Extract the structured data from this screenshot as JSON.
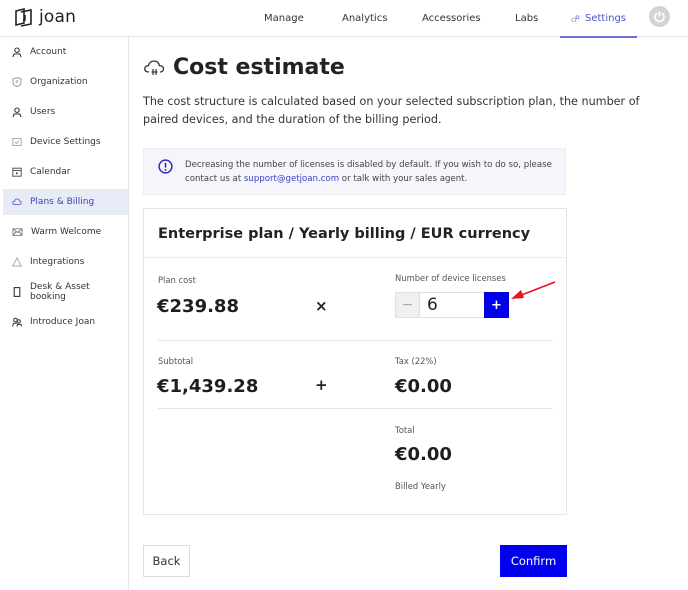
{
  "app": {
    "logo_text": "joan"
  },
  "topnav": {
    "items": [
      {
        "label": "Manage",
        "icon": "manage-icon",
        "active": false
      },
      {
        "label": "Analytics",
        "icon": "analytics-icon",
        "active": false
      },
      {
        "label": "Accessories",
        "icon": "basket-icon",
        "active": false
      },
      {
        "label": "Labs",
        "icon": "lightbulb-icon",
        "active": false
      },
      {
        "label": "Settings",
        "icon": "gears-icon",
        "active": true
      }
    ],
    "power_icon": "power-icon"
  },
  "sidebar": {
    "items": [
      {
        "label": "Account",
        "icon": "user-icon"
      },
      {
        "label": "Organization",
        "icon": "shield-icon"
      },
      {
        "label": "Users",
        "icon": "user-icon"
      },
      {
        "label": "Device Settings",
        "icon": "device-icon"
      },
      {
        "label": "Calendar",
        "icon": "calendar-icon"
      },
      {
        "label": "Plans & Billing",
        "icon": "cloud-icon",
        "active": true
      },
      {
        "label": "Warm Welcome",
        "icon": "envelope-icon"
      },
      {
        "label": "Integrations",
        "icon": "triangle-icon"
      },
      {
        "label": "Desk & Asset booking",
        "icon": "phone-icon"
      },
      {
        "label": "Introduce Joan",
        "icon": "users-icon"
      }
    ]
  },
  "page": {
    "title": "Cost estimate",
    "intro": "The cost structure is calculated based on your selected subscription plan, the number of paired devices, and the duration of the billing period.",
    "info": {
      "text_before": "Decreasing the number of licenses is disabled by default. If you wish to do so, please contact us at ",
      "link": "support@getjoan.com",
      "text_after": " or talk with your sales agent."
    }
  },
  "card": {
    "title": "Enterprise plan / Yearly billing / EUR currency",
    "plan_cost_label": "Plan cost",
    "plan_cost": "€239.88",
    "times_op": "×",
    "licenses_label": "Number of device licenses",
    "licenses_value": "6",
    "minus_label": "−",
    "plus_label": "+",
    "subtotal_label": "Subtotal",
    "subtotal": "€1,439.28",
    "plus_op": "+",
    "tax_label": "Tax (22%)",
    "tax": "€0.00",
    "total_label": "Total",
    "total": "€0.00",
    "billing_note": "Billed Yearly"
  },
  "actions": {
    "back_label": "Back",
    "confirm_label": "Confirm"
  },
  "colors": {
    "accent": "#0000ee",
    "active_nav": "#4b4fc9",
    "annotation_arrow": "#e8141b"
  }
}
